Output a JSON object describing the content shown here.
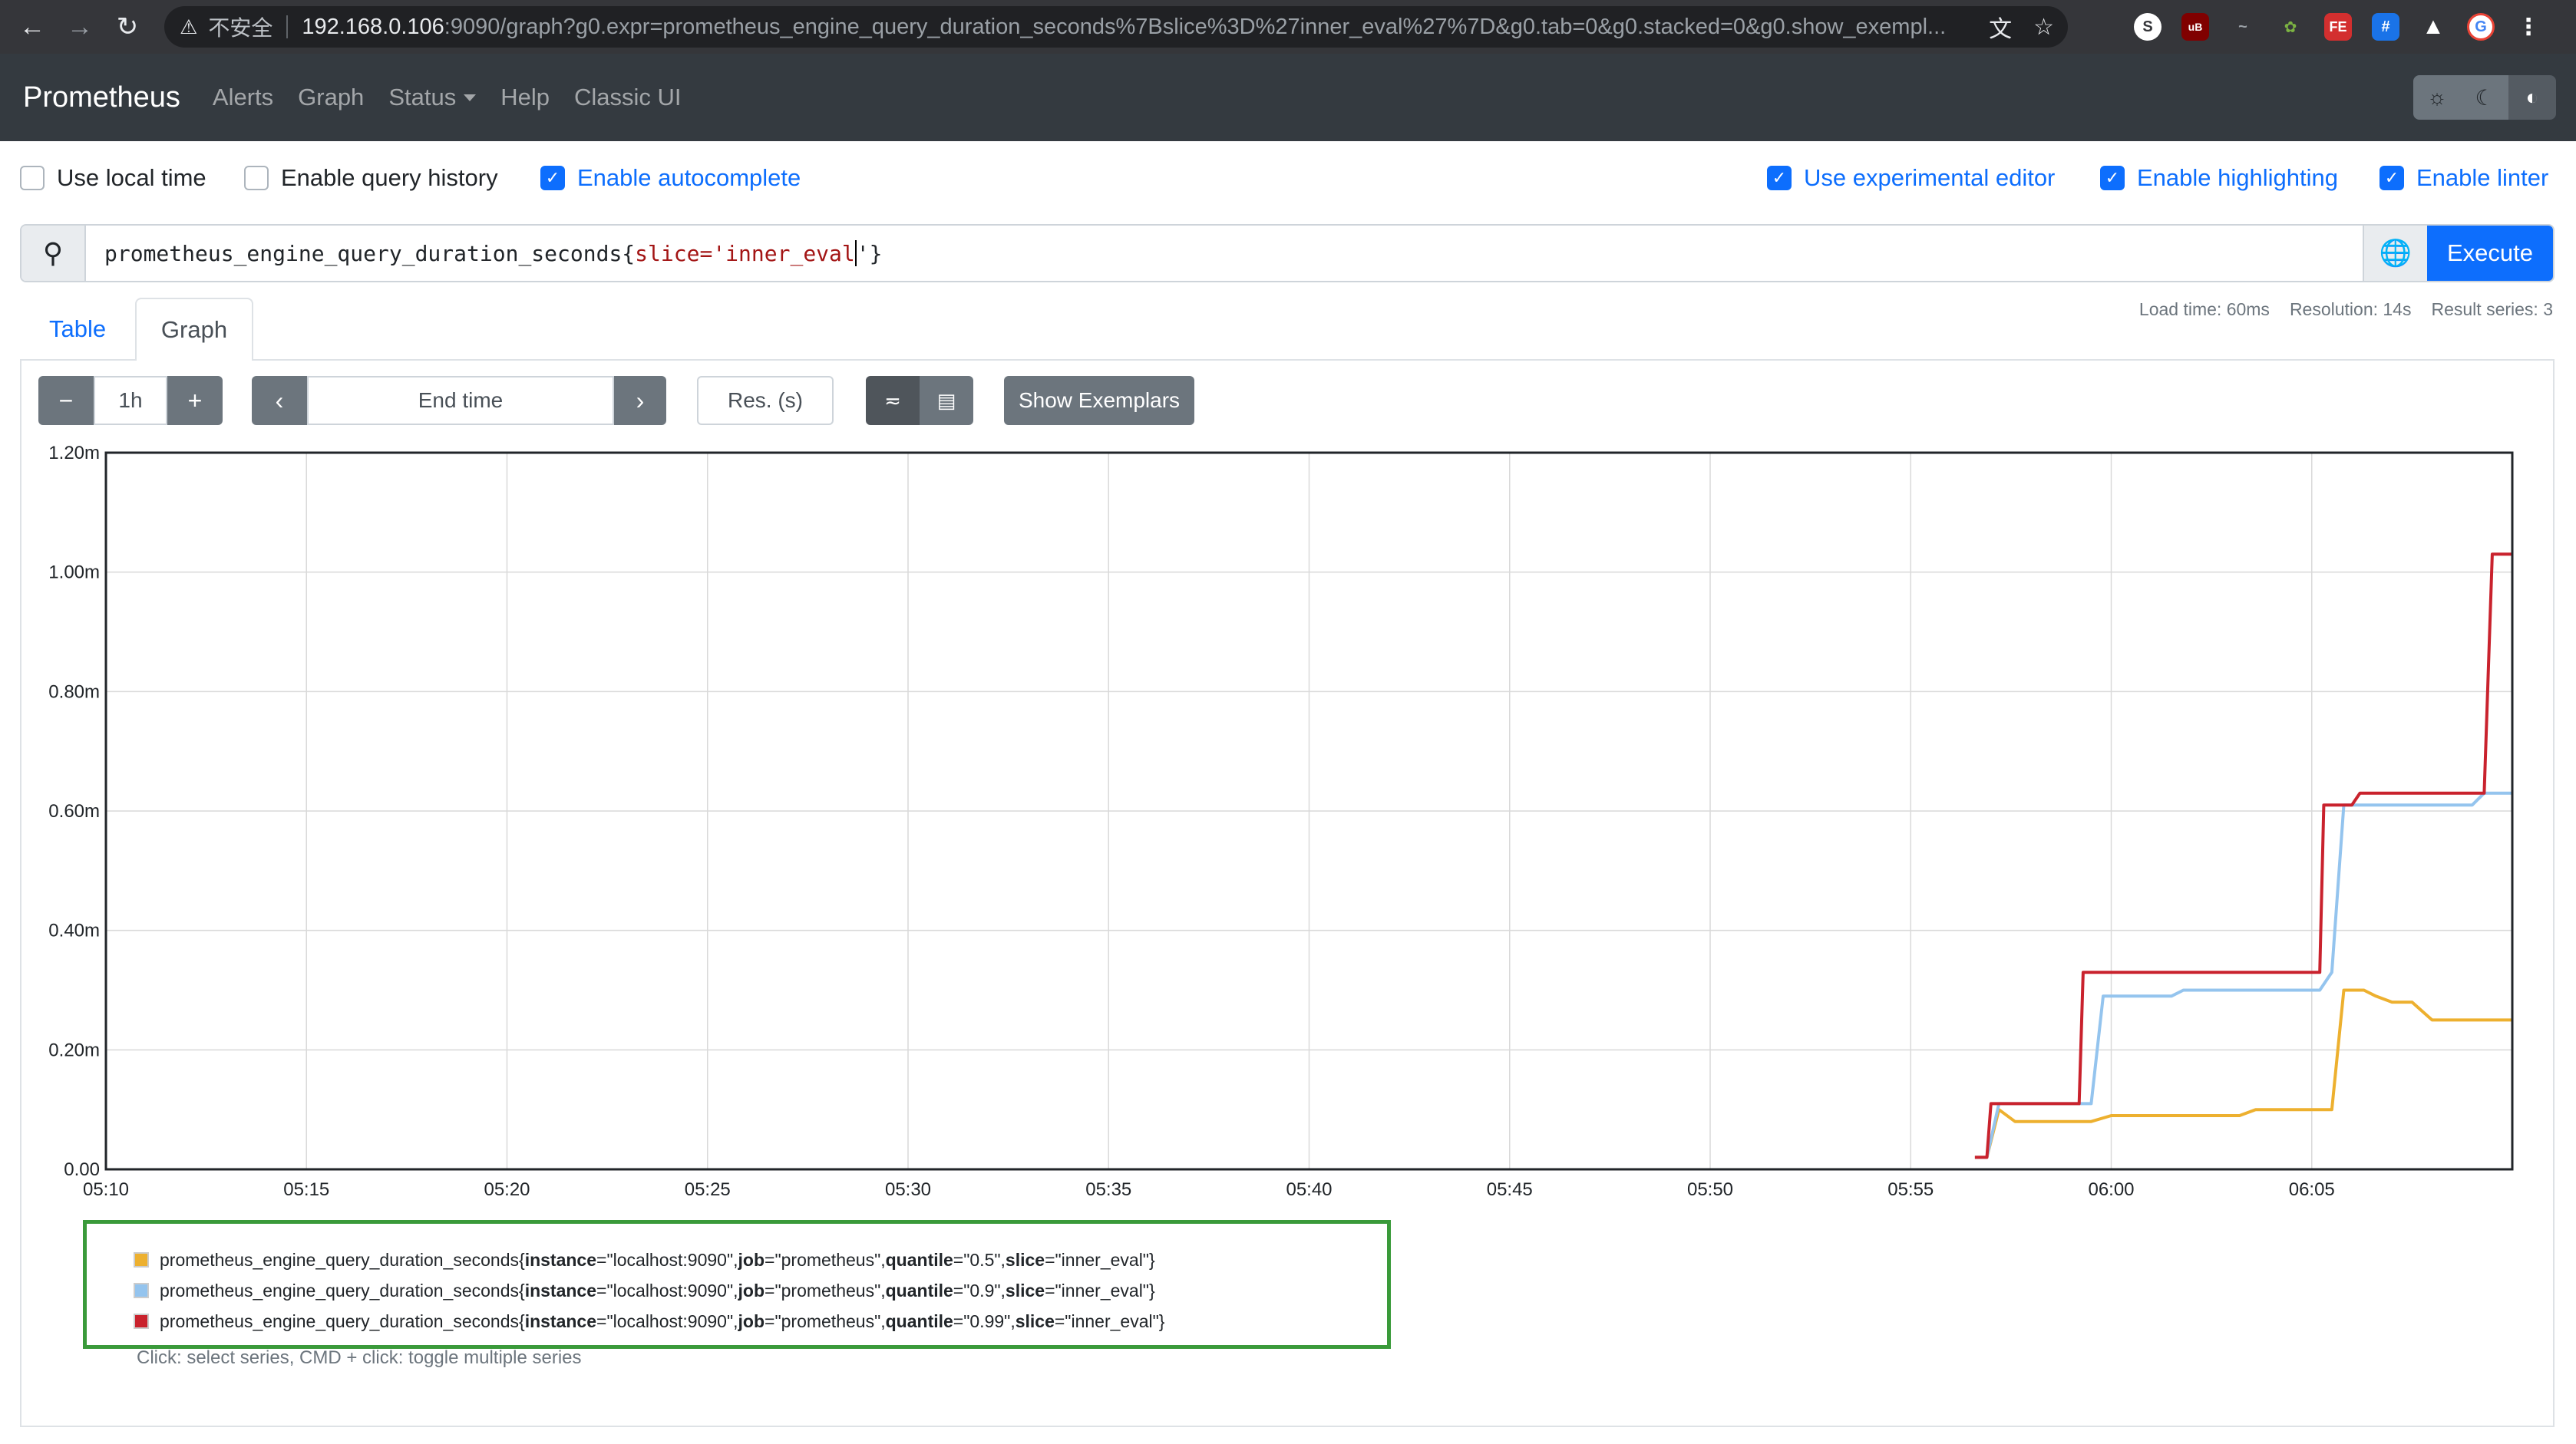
{
  "browser": {
    "insecure_label": "不安全",
    "url_host": "192.168.0.106",
    "url_rest": ":9090/graph?g0.expr=prometheus_engine_query_duration_seconds%7Bslice%3D%27inner_eval%27%7D&g0.tab=0&g0.stacked=0&g0.show_exempl..."
  },
  "navbar": {
    "brand": "Prometheus",
    "links": [
      "Alerts",
      "Graph",
      "Status",
      "Help",
      "Classic UI"
    ]
  },
  "options": {
    "use_local_time": {
      "label": "Use local time",
      "checked": false
    },
    "enable_query_history": {
      "label": "Enable query history",
      "checked": false
    },
    "enable_autocomplete": {
      "label": "Enable autocomplete",
      "checked": true
    },
    "use_experimental_editor": {
      "label": "Use experimental editor",
      "checked": true
    },
    "enable_highlighting": {
      "label": "Enable highlighting",
      "checked": true
    },
    "enable_linter": {
      "label": "Enable linter",
      "checked": true
    }
  },
  "query": {
    "metric": "prometheus_engine_query_duration_seconds{",
    "label_key": "slice=",
    "label_value": "'inner_eval",
    "closing": "'}",
    "execute_label": "Execute"
  },
  "tabs": {
    "table": "Table",
    "graph": "Graph"
  },
  "stats": {
    "load_time": "Load time: 60ms",
    "resolution": "Resolution: 14s",
    "result_series": "Result series: 3"
  },
  "controls": {
    "range": "1h",
    "end_time_placeholder": "End time",
    "res_placeholder": "Res. (s)",
    "show_exemplars": "Show Exemplars"
  },
  "chart_data": {
    "type": "line",
    "x_tick_labels": [
      "05:10",
      "05:15",
      "05:20",
      "05:25",
      "05:30",
      "05:35",
      "05:40",
      "05:45",
      "05:50",
      "05:55",
      "06:00",
      "06:05"
    ],
    "y_tick_labels": [
      "0.00",
      "0.20m",
      "0.40m",
      "0.60m",
      "0.80m",
      "1.00m",
      "1.20m"
    ],
    "ylim": [
      0,
      1.2
    ],
    "xlim_minutes": [
      0,
      60
    ],
    "grid": true,
    "series": [
      {
        "name": "prometheus_engine_query_duration_seconds{instance=\"localhost:9090\", job=\"prometheus\", quantile=\"0.5\", slice=\"inner_eval\"}",
        "color": "#edb02f",
        "points": [
          [
            46.6,
            0.02
          ],
          [
            46.9,
            0.02
          ],
          [
            47.2,
            0.1
          ],
          [
            47.6,
            0.08
          ],
          [
            49.5,
            0.08
          ],
          [
            50.0,
            0.09
          ],
          [
            53.2,
            0.09
          ],
          [
            53.6,
            0.1
          ],
          [
            55.3,
            0.1
          ],
          [
            55.5,
            0.1
          ],
          [
            55.8,
            0.3
          ],
          [
            56.3,
            0.3
          ],
          [
            56.6,
            0.29
          ],
          [
            57.0,
            0.28
          ],
          [
            57.5,
            0.28
          ],
          [
            58.0,
            0.25
          ],
          [
            60.0,
            0.25
          ]
        ]
      },
      {
        "name": "prometheus_engine_query_duration_seconds{instance=\"localhost:9090\", job=\"prometheus\", quantile=\"0.9\", slice=\"inner_eval\"}",
        "color": "#94c4ee",
        "points": [
          [
            46.6,
            0.02
          ],
          [
            46.9,
            0.02
          ],
          [
            47.2,
            0.11
          ],
          [
            49.5,
            0.11
          ],
          [
            49.8,
            0.29
          ],
          [
            51.5,
            0.29
          ],
          [
            51.8,
            0.3
          ],
          [
            55.2,
            0.3
          ],
          [
            55.5,
            0.33
          ],
          [
            55.8,
            0.61
          ],
          [
            56.2,
            0.61
          ],
          [
            56.5,
            0.61
          ],
          [
            59.0,
            0.61
          ],
          [
            59.3,
            0.63
          ],
          [
            60.0,
            0.63
          ]
        ]
      },
      {
        "name": "prometheus_engine_query_duration_seconds{instance=\"localhost:9090\", job=\"prometheus\", quantile=\"0.99\", slice=\"inner_eval\"}",
        "color": "#c9222d",
        "points": [
          [
            46.6,
            0.02
          ],
          [
            46.9,
            0.02
          ],
          [
            47.0,
            0.11
          ],
          [
            49.2,
            0.11
          ],
          [
            49.3,
            0.33
          ],
          [
            55.2,
            0.33
          ],
          [
            55.3,
            0.61
          ],
          [
            56.0,
            0.61
          ],
          [
            56.2,
            0.63
          ],
          [
            59.3,
            0.63
          ],
          [
            59.5,
            1.03
          ],
          [
            60.0,
            1.03
          ]
        ]
      }
    ]
  },
  "legend": {
    "rows": [
      {
        "metric": "prometheus_engine_query_duration_seconds{",
        "instance": "\"localhost:9090\"",
        "job": "\"prometheus\"",
        "quantile": "\"0.5\"",
        "slice": "\"inner_eval\""
      },
      {
        "metric": "prometheus_engine_query_duration_seconds{",
        "instance": "\"localhost:9090\"",
        "job": "\"prometheus\"",
        "quantile": "\"0.9\"",
        "slice": "\"inner_eval\""
      },
      {
        "metric": "prometheus_engine_query_duration_seconds{",
        "instance": "\"localhost:9090\"",
        "job": "\"prometheus\"",
        "quantile": "\"0.99\"",
        "slice": "\"inner_eval\""
      }
    ],
    "hint": "Click: select series, CMD + click: toggle multiple series"
  }
}
